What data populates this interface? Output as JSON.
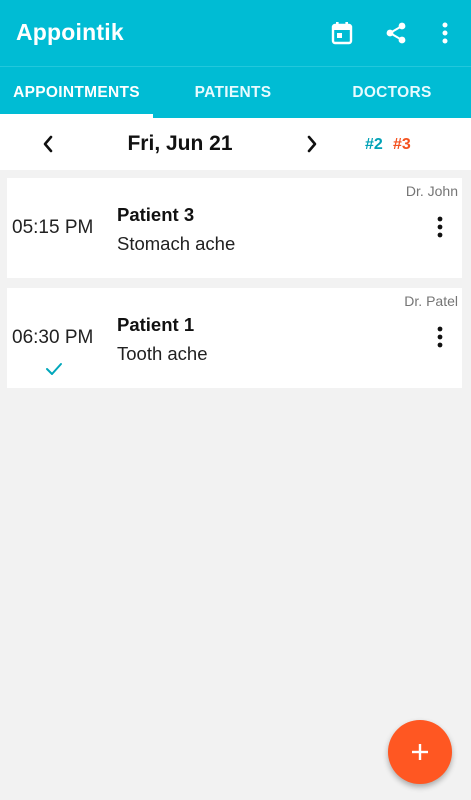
{
  "app": {
    "title": "Appointik"
  },
  "toolbar": {
    "icons": [
      "calendar-icon",
      "share-icon",
      "more-vert-icon"
    ]
  },
  "tabs": [
    {
      "label": "APPOINTMENTS",
      "active": true
    },
    {
      "label": "PATIENTS",
      "active": false
    },
    {
      "label": "DOCTORS",
      "active": false
    }
  ],
  "datebar": {
    "date": "Fri, Jun 21",
    "count_a": "#2",
    "count_b": "#3",
    "count_a_color": "#00a1b5",
    "count_b_color": "#f4511e"
  },
  "appointments": [
    {
      "time": "05:15 PM",
      "patient": "Patient 3",
      "reason": "Stomach ache",
      "doctor": "Dr. John",
      "completed": false
    },
    {
      "time": "06:30 PM",
      "patient": "Patient 1",
      "reason": "Tooth ache",
      "doctor": "Dr. Patel",
      "completed": true
    }
  ],
  "fab": {
    "label": "+"
  },
  "colors": {
    "primary": "#00bcd4",
    "accent": "#ff5722",
    "background": "#f2f2f2"
  }
}
